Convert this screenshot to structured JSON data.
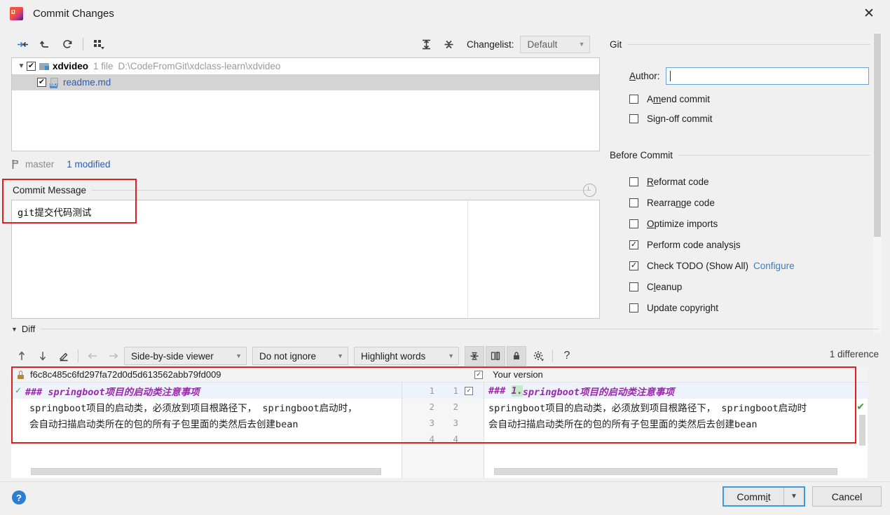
{
  "window": {
    "title": "Commit Changes",
    "app_icon": "intellij-idea-icon",
    "close_label": "✕"
  },
  "toolbar": {
    "buttons": [
      {
        "name": "show-diff-icon",
        "glyph": "diff"
      },
      {
        "name": "revert-icon",
        "glyph": "revert"
      },
      {
        "name": "refresh-icon",
        "glyph": "refresh"
      },
      {
        "name": "group-by-icon",
        "glyph": "group"
      }
    ],
    "expand_all_label": "expand-all-icon",
    "collapse_all_label": "collapse-all-icon",
    "changelist_label": "Changelist:",
    "changelist_value": "Default"
  },
  "file_tree": {
    "root": {
      "name": "xdvideo",
      "file_count": "1 file",
      "path": "D:\\CodeFromGit\\xdclass-learn\\xdvideo",
      "checked": true,
      "expanded": true
    },
    "files": [
      {
        "name": "readme.md",
        "checked": true,
        "selected": true,
        "type": "MD"
      }
    ]
  },
  "status_bar": {
    "branch": "master",
    "modified": "1 modified"
  },
  "commit_message": {
    "legend": "Commit Message",
    "value": "git提交代码测试",
    "history_icon": "clock-icon"
  },
  "git_panel": {
    "legend": "Git",
    "author_label": "Author:",
    "author_value": "",
    "checkboxes": [
      {
        "label": "Amend commit",
        "checked": false,
        "mnemonic": "m"
      },
      {
        "label": "Sign-off commit",
        "checked": false,
        "mnemonic": "g"
      }
    ]
  },
  "before_commit": {
    "legend": "Before Commit",
    "items": [
      {
        "label": "Reformat code",
        "checked": false
      },
      {
        "label": "Rearrange code",
        "checked": false
      },
      {
        "label": "Optimize imports",
        "checked": false
      },
      {
        "label": "Perform code analysis",
        "checked": true
      },
      {
        "label": "Check TODO (Show All)",
        "checked": true,
        "link": "Configure"
      },
      {
        "label": "Cleanup",
        "checked": false
      },
      {
        "label": "Update copyright",
        "checked": false
      }
    ]
  },
  "diff": {
    "legend": "Diff",
    "viewer_mode": "Side-by-side viewer",
    "ignore_mode": "Do not ignore",
    "highlight_mode": "Highlight words",
    "difference_count": "1 difference",
    "left_header": "f6c8c485c6fd297fa72d0d5d613562abb79fd009",
    "right_header": "Your version",
    "right_header_checked": true,
    "left_lines": [
      {
        "text": "### springboot项目的启动类注意事项",
        "style": "md-head",
        "changed": true
      },
      {
        "text": "springboot项目的启动类，必须放到项目根路径下， springboot启动时，",
        "style": "plain",
        "changed": false
      },
      {
        "text": "会自动扫描启动类所在的包的所有子包里面的类然后去创建bean",
        "style": "plain",
        "changed": false
      }
    ],
    "right_lines": [
      {
        "prefix": "### ",
        "highlight": "1.",
        "suffix": "springboot项目的启动类注意事项",
        "style": "md-head",
        "changed": true,
        "checked": true
      },
      {
        "prefix": "",
        "highlight": "",
        "suffix": "springboot项目的启动类，必须放到项目根路径下， springboot启动时",
        "style": "plain",
        "changed": false,
        "checked": false
      },
      {
        "prefix": "",
        "highlight": "",
        "suffix": "会自动扫描启动类所在的包的所有子包里面的类然后去创建bean",
        "style": "plain",
        "changed": false,
        "checked": false
      }
    ],
    "line_numbers": [
      {
        "left": "1",
        "right": "1"
      },
      {
        "left": "2",
        "right": "2"
      },
      {
        "left": "3",
        "right": "3"
      },
      {
        "left": "4",
        "right": "4"
      }
    ]
  },
  "footer": {
    "help_label": "?",
    "commit_label": "Commit",
    "commit_dropdown": "⌄",
    "cancel_label": "Cancel"
  },
  "colors": {
    "accent_blue": "#3c9ae0",
    "link_blue": "#3a7cc0",
    "highlight_red": "#e02020",
    "md_header_purple": "#9c27b0",
    "added_green": "#c6ecc6",
    "selection_gray": "#d4d4d4"
  }
}
